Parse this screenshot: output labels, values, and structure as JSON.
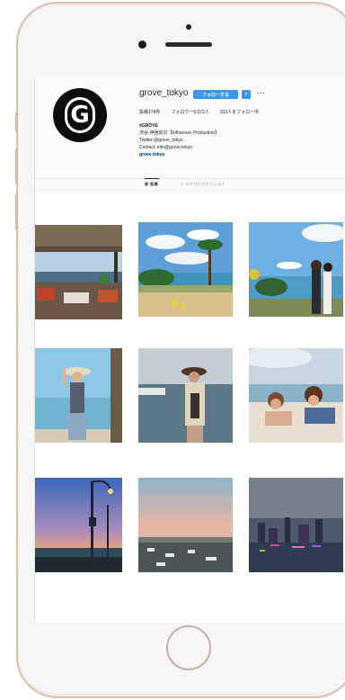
{
  "profile": {
    "username": "grove_tokyo",
    "avatar_letter": "G",
    "follow_label": "フォローする",
    "dropdown_icon": "▾",
    "more_icon": "···",
    "stats": {
      "posts": "投稿174件",
      "followers": "フォロワー5,072人",
      "following": "310人をフォロー中"
    },
    "bio": {
      "name": "#GROVE",
      "line1": "渋谷·神宮前の【Influencer Production】",
      "line2": "Twitter:@grove_tokyo",
      "line3": "Contact: info@grove.tokyo",
      "website": "grove.tokyo"
    }
  },
  "tabs": {
    "posts": "▦ 投稿",
    "tagged": "◻ タグ付けされている人"
  },
  "photos": [
    {
      "name": "terrace-restaurant-photo"
    },
    {
      "name": "tropical-beach-palms-photo"
    },
    {
      "name": "couple-at-coast-photo"
    },
    {
      "name": "woman-in-hat-beach-photo"
    },
    {
      "name": "woman-on-pier-photo"
    },
    {
      "name": "friends-lying-on-sand-photo"
    },
    {
      "name": "sunset-street-lamps-photo"
    },
    {
      "name": "harbor-pink-sky-photo"
    },
    {
      "name": "city-night-skyline-photo"
    }
  ],
  "colors": {
    "follow_button": "#3897f0",
    "phone_body": "#f4e6e0",
    "avatar_bg": "#0c0c0c"
  }
}
